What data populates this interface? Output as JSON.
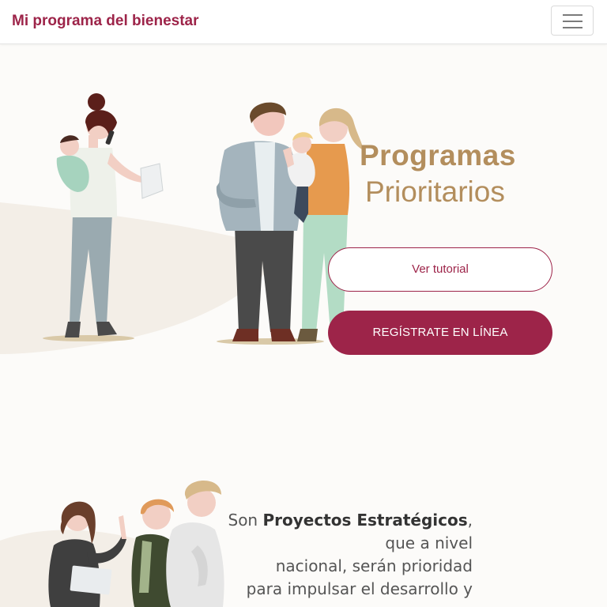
{
  "navbar": {
    "brand": "Mi programa del bienestar",
    "menu_icon": "hamburger-menu-icon"
  },
  "hero": {
    "title_bold": "Programas",
    "title_light": "Prioritarios",
    "tutorial_button": "Ver tutorial",
    "register_button": "REGÍSTRATE EN LÍNEA"
  },
  "strategic": {
    "prefix": "Son",
    "bold": "Proyectos Estratégicos",
    "line1_tail": ", que a nivel",
    "line2": "nacional, serán prioridad",
    "line3": "para impulsar el desarrollo y"
  },
  "colors": {
    "brand": "#9d2449",
    "gold": "#b38e5d",
    "wave": "#f3eee7"
  }
}
